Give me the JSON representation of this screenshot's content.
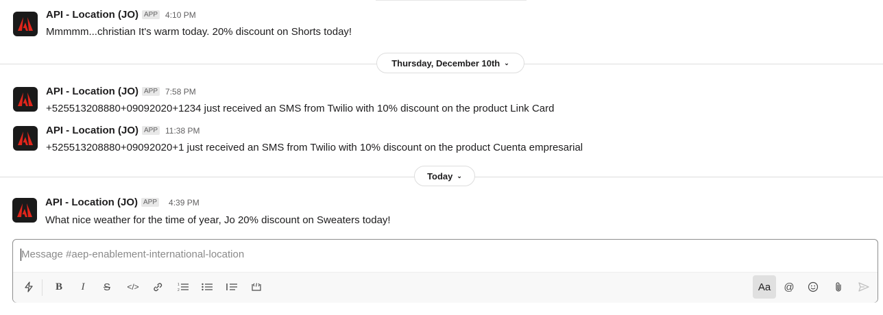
{
  "messages": [
    {
      "sender": "API - Location (JO)",
      "badge": "APP",
      "time": "4:10 PM",
      "text": "Mmmmm...christian It's warm today. 20% discount on Shorts today!"
    },
    {
      "sender": "API - Location (JO)",
      "badge": "APP",
      "time": "7:58 PM",
      "text": "+525513208880+09092020+1234 just received an SMS from Twilio with 10% discount on the product Link Card"
    },
    {
      "sender": "API - Location (JO)",
      "badge": "APP",
      "time": "11:38 PM",
      "text": "+525513208880+09092020+1 just received an SMS from Twilio with 10% discount on the product Cuenta empresarial"
    },
    {
      "sender": "API - Location (JO)",
      "badge": "APP",
      "time": "4:39 PM",
      "text": "What nice weather for the time of year, Jo 20% discount on Sweaters today!"
    }
  ],
  "dividers": [
    {
      "label": "Thursday, December 10th"
    },
    {
      "label": "Today"
    }
  ],
  "composer": {
    "placeholder": "Message #aep-enablement-international-location",
    "text_style_label": "Aa"
  },
  "colors": {
    "avatar_bg": "#1a1a1a",
    "brand_red": "#e1251b",
    "send_disabled": "#c0c0c0"
  }
}
